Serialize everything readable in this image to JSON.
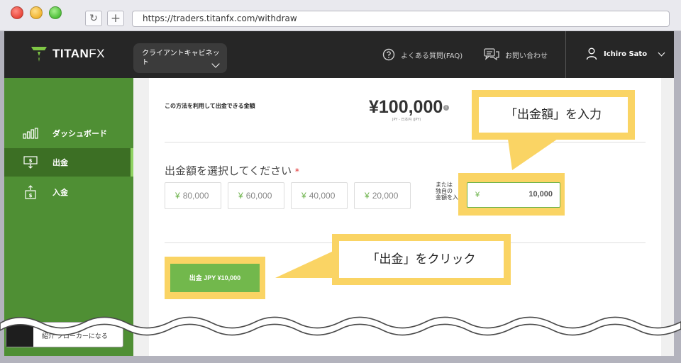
{
  "browser": {
    "url": "https://traders.titanfx.com/withdraw",
    "reload_icon": "reload-icon",
    "new_tab_icon": "plus-icon"
  },
  "header": {
    "brand": "TITAN",
    "brand_fx": "FX",
    "cabinet_line1": "クライアントキャビネッ",
    "cabinet_line2": "ト",
    "faq": "よくある質問(FAQ)",
    "contact": "お問い合わせ",
    "user_name": "Ichiro Sato"
  },
  "sidebar": {
    "items": [
      {
        "label": "ダッシュボード",
        "icon": "bar-chart-icon"
      },
      {
        "label": "出金",
        "icon": "withdraw-icon",
        "active": true
      },
      {
        "label": "入金",
        "icon": "deposit-icon"
      }
    ],
    "broker_line1": "紹介",
    "broker_line2": "ブローカーになる"
  },
  "withdraw": {
    "available_label": "この方法を利用して出金できる金額",
    "available_amount": "¥100,000",
    "available_currency": "JPY - 日本円 (JPY)",
    "select_label": "出金額を選択してください",
    "required_mark": "*",
    "currency_symbol": "¥",
    "presets": [
      "80,000",
      "60,000",
      "40,000",
      "20,000"
    ],
    "or_text_1": "または",
    "or_text_2": "独自の",
    "or_text_3": "金額を入",
    "custom_value": "10,000",
    "submit_label": "出金 JPY ¥10,000"
  },
  "callouts": {
    "amount": "「出金額」を入力",
    "click": "「出金」をクリック"
  },
  "colors": {
    "brand_green": "#4f8f34",
    "active_green": "#3c6f24",
    "button_green": "#72b84c",
    "highlight_yellow": "#fad464",
    "header_dark": "#262626"
  }
}
